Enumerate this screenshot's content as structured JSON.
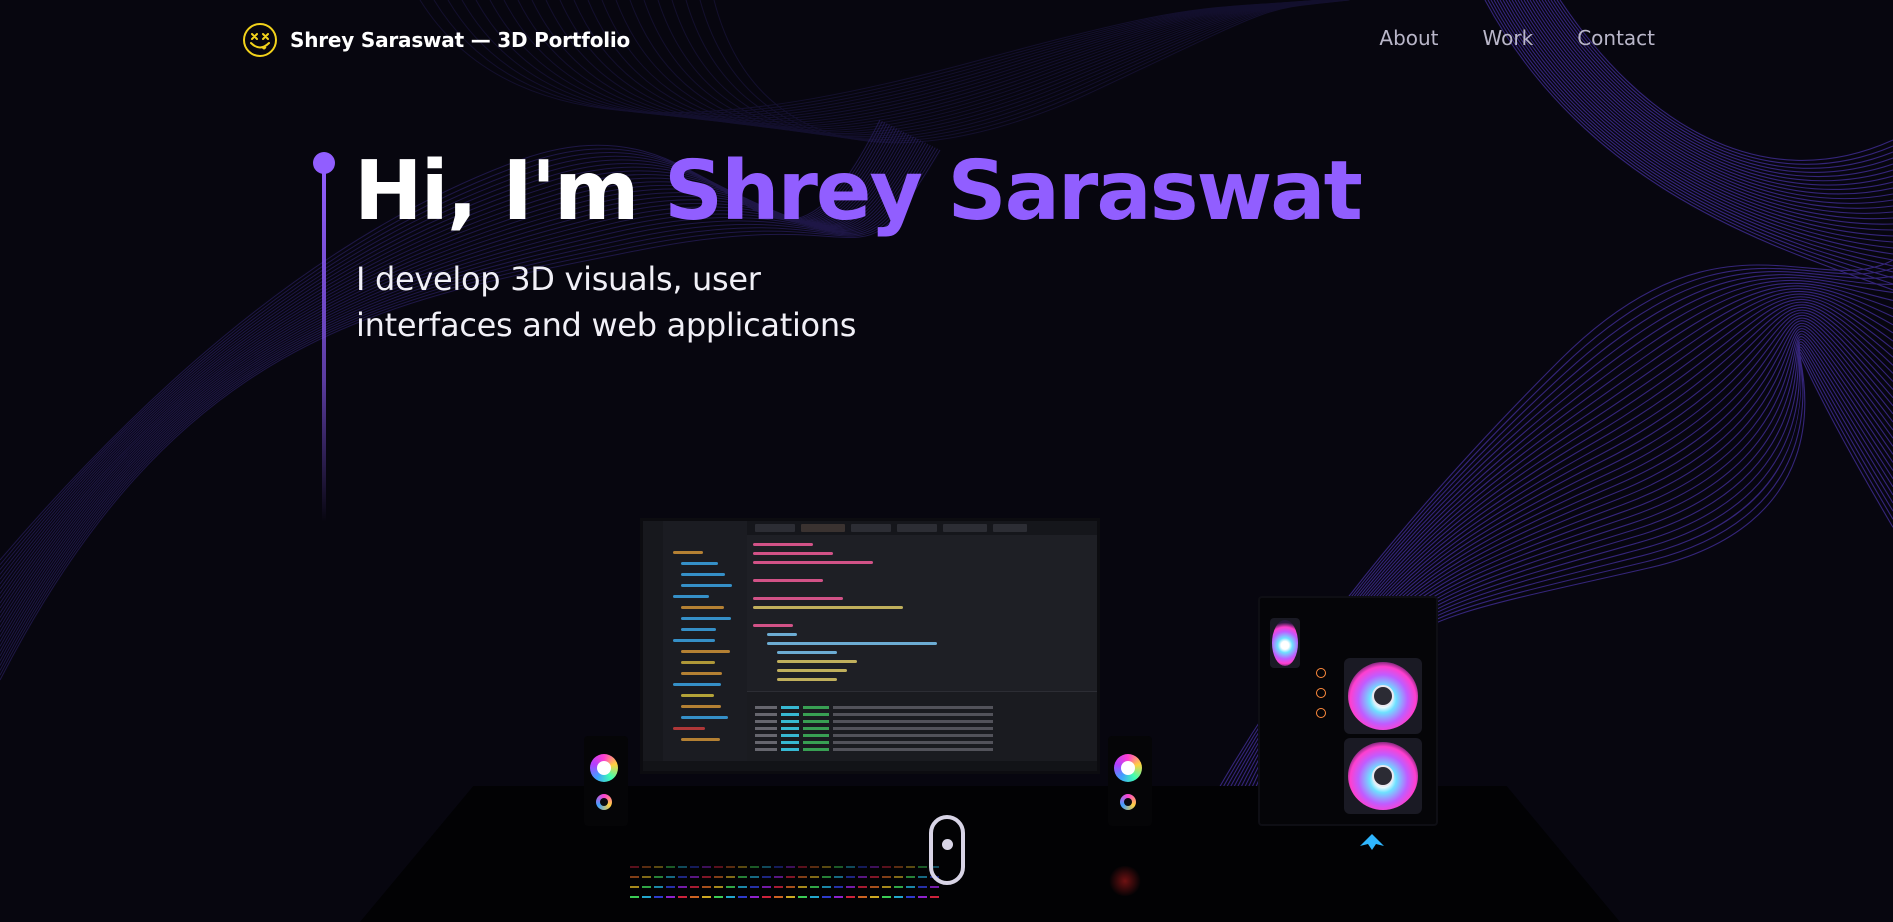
{
  "header": {
    "brand_title": "Shrey Saraswat — 3D Portfolio",
    "logo_icon": "smiley-x-eyes-icon",
    "nav_links": [
      {
        "label": "About"
      },
      {
        "label": "Work"
      },
      {
        "label": "Contact"
      }
    ]
  },
  "hero": {
    "greeting": "Hi, I'm ",
    "name": "Shrey Saraswat",
    "subtitle_line1": "I develop 3D visuals, user",
    "subtitle_line2": "interfaces and web applications"
  },
  "scene": {
    "scroll_indicator_icon": "mouse-scroll-icon",
    "objects": [
      "monitor",
      "speakers",
      "pc-tower",
      "keyboard",
      "desk"
    ]
  },
  "colors": {
    "background": "#07060f",
    "accent": "#915eff",
    "text": "#ffffff",
    "nav_text": "#b9b6c9",
    "logo": "#f2d21b"
  }
}
